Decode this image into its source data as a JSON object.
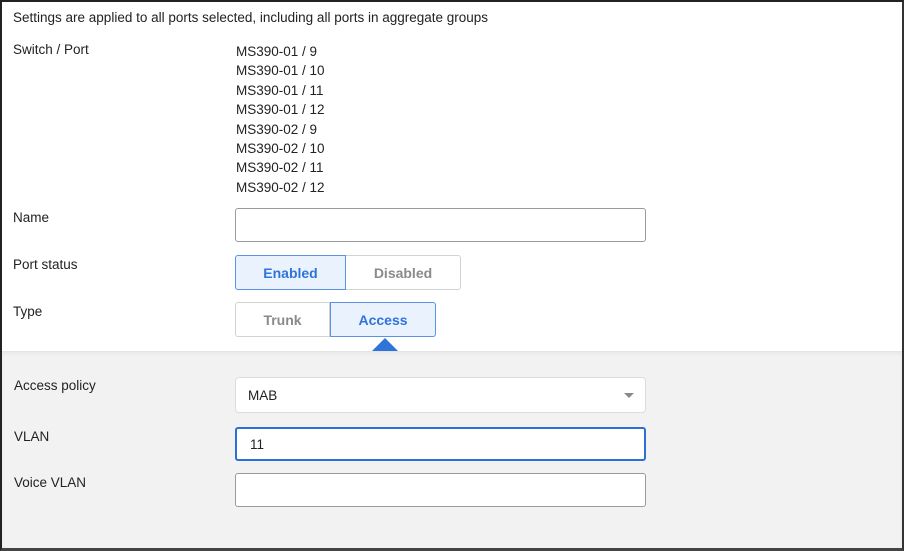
{
  "notice": "Settings are applied to all ports selected, including all ports in aggregate groups",
  "switch_port": {
    "label": "Switch / Port",
    "ports": [
      "MS390-01 / 9",
      "MS390-01 / 10",
      "MS390-01 / 11",
      "MS390-01 / 12",
      "MS390-02 / 9",
      "MS390-02 / 10",
      "MS390-02 / 11",
      "MS390-02 / 12"
    ]
  },
  "name": {
    "label": "Name",
    "value": "",
    "placeholder": ""
  },
  "port_status": {
    "label": "Port status",
    "options": [
      "Enabled",
      "Disabled"
    ],
    "selected": "Enabled"
  },
  "type": {
    "label": "Type",
    "options": [
      "Trunk",
      "Access"
    ],
    "selected": "Access"
  },
  "access_policy": {
    "label": "Access policy",
    "value": "MAB"
  },
  "vlan": {
    "label": "VLAN",
    "value": "11"
  },
  "voice_vlan": {
    "label": "Voice VLAN",
    "value": ""
  },
  "colors": {
    "accent": "#2f74d8",
    "active_bg": "#eaf2fe",
    "panel_bg": "#f2f2f2"
  }
}
